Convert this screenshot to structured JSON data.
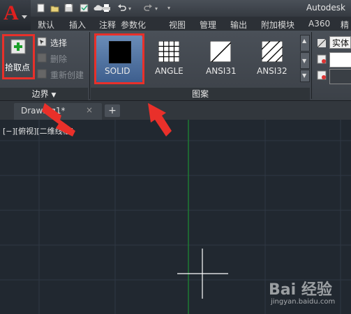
{
  "app": {
    "title": "Autodesk",
    "logo_letter": "A"
  },
  "menu_tabs": [
    {
      "label": "默认"
    },
    {
      "label": "插入"
    },
    {
      "label": "注释"
    },
    {
      "label": "参数化"
    },
    {
      "label": "视图"
    },
    {
      "label": "管理"
    },
    {
      "label": "输出"
    },
    {
      "label": "附加模块"
    },
    {
      "label": "A360"
    },
    {
      "label": "精"
    }
  ],
  "boundary_panel": {
    "pick_points_label": "拾取点",
    "select_label": "选择",
    "delete_label": "删除",
    "recreate_label": "重新创建",
    "title": "边界"
  },
  "pattern_panel": {
    "title": "图案",
    "patterns": [
      {
        "label": "SOLID",
        "selected": true
      },
      {
        "label": "ANGLE",
        "selected": false
      },
      {
        "label": "ANSI31",
        "selected": false
      },
      {
        "label": "ANSI32",
        "selected": false
      }
    ]
  },
  "properties_panel": {
    "type_label": "实体"
  },
  "file_tabs": {
    "name": "Drawing1*",
    "close": "×",
    "add": "+"
  },
  "viewport": {
    "label": "[−][俯视][二维线框]"
  },
  "watermark": {
    "brand": "Bai 经验",
    "url": "jingyan.baidu.com"
  },
  "colors": {
    "accent_red": "#e9302a",
    "y_axis_green": "#1e7a32",
    "canvas_bg": "#212830"
  }
}
